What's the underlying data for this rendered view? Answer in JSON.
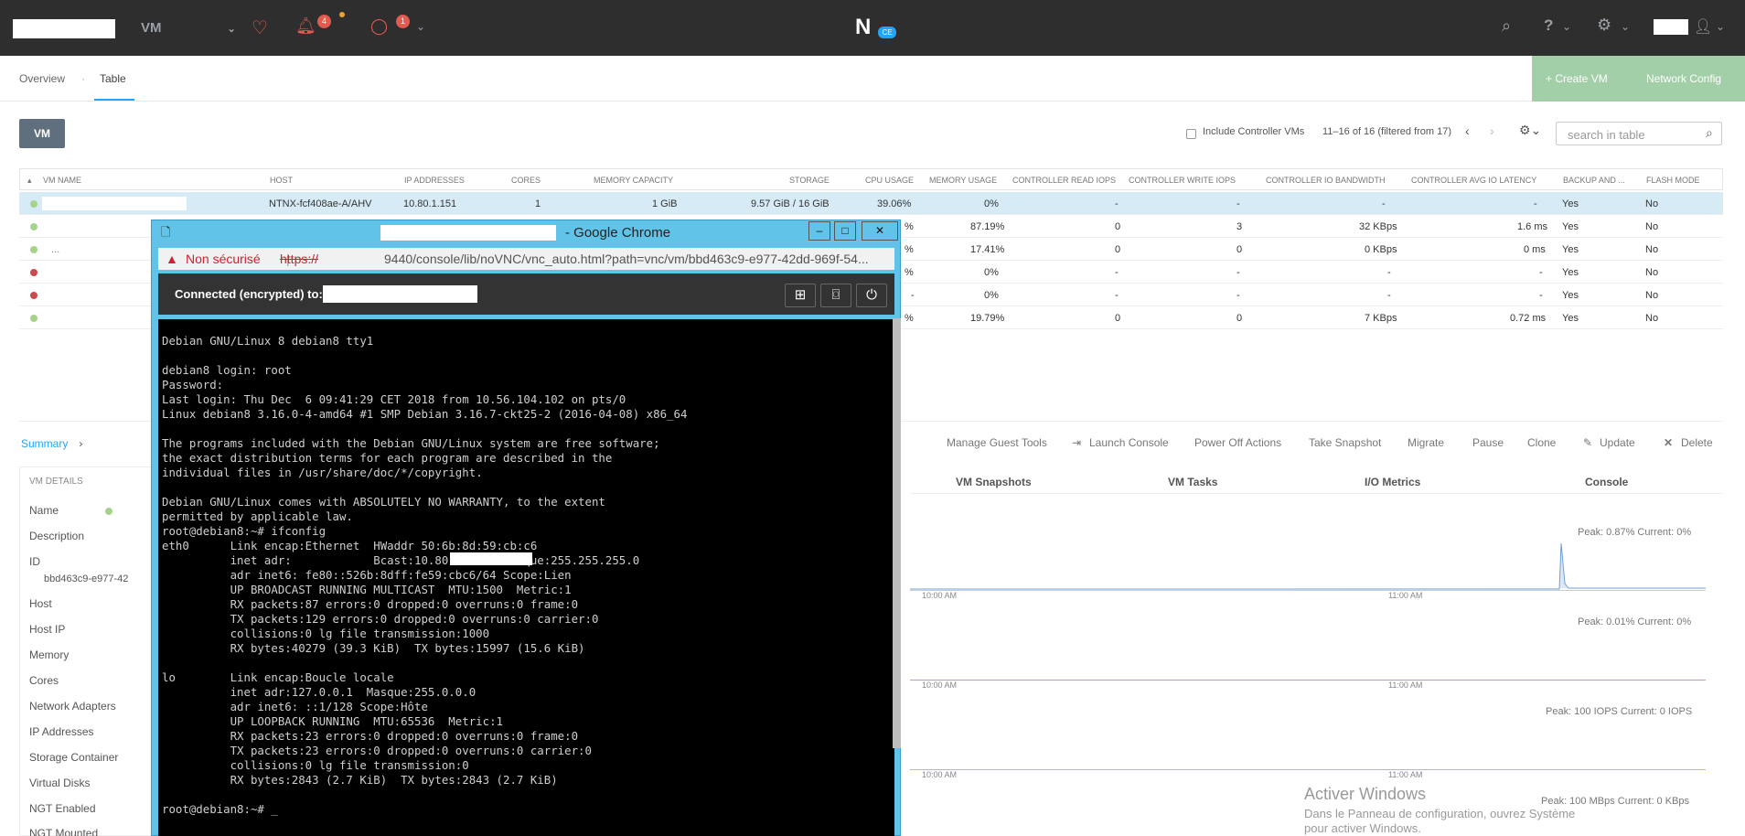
{
  "topbar": {
    "section": "VM",
    "alerts_count": "4",
    "tasks_count": "1",
    "logo": "N",
    "logo_badge": "CE"
  },
  "nav": {
    "tabs": [
      "Overview",
      "Table"
    ],
    "create_vm": "+   Create VM",
    "network_config": "Network Config"
  },
  "toolbar": {
    "vm_button": "VM",
    "include_cvms": "Include Controller VMs",
    "range": "11–16 of 16 (filtered from 17)",
    "search_placeholder": "search in table"
  },
  "table": {
    "headers": [
      "VM NAME",
      "HOST",
      "IP ADDRESSES",
      "CORES",
      "MEMORY CAPACITY",
      "STORAGE",
      "CPU USAGE",
      "MEMORY USAGE",
      "CONTROLLER READ IOPS",
      "CONTROLLER WRITE IOPS",
      "CONTROLLER IO BANDWIDTH",
      "CONTROLLER AVG IO LATENCY",
      "BACKUP AND ...",
      "FLASH MODE"
    ],
    "rows": [
      {
        "status": "green",
        "host": "NTNX-fcf408ae-A/AHV",
        "ip": "10.80.1.151",
        "cores": "1",
        "mem": "1 GiB",
        "storage": "9.57 GiB / 16 GiB",
        "cpu": "39.06%",
        "memu": "0%",
        "rd": "-",
        "wr": "-",
        "bw": "-",
        "lat": "-",
        "backup": "Yes",
        "flash": "No"
      },
      {
        "status": "green",
        "cpu": "%",
        "memu": "87.19%",
        "rd": "0",
        "wr": "3",
        "bw": "32 KBps",
        "lat": "1.6 ms",
        "backup": "Yes",
        "flash": "No"
      },
      {
        "status": "green",
        "name": "...",
        "cpu": "%",
        "memu": "17.41%",
        "rd": "0",
        "wr": "0",
        "bw": "0 KBps",
        "lat": "0 ms",
        "backup": "Yes",
        "flash": "No"
      },
      {
        "status": "red",
        "cpu": "%",
        "memu": "0%",
        "rd": "-",
        "wr": "-",
        "bw": "-",
        "lat": "-",
        "backup": "Yes",
        "flash": "No"
      },
      {
        "status": "red",
        "cpu": "-",
        "memu": "0%",
        "rd": "-",
        "wr": "-",
        "bw": "-",
        "lat": "-",
        "backup": "Yes",
        "flash": "No"
      },
      {
        "status": "green",
        "cpu": "%",
        "memu": "19.79%",
        "rd": "0",
        "wr": "0",
        "bw": "7 KBps",
        "lat": "0.72 ms",
        "backup": "Yes",
        "flash": "No"
      }
    ]
  },
  "summary": {
    "link": "Summary",
    "actions": [
      "Manage Guest Tools",
      "Launch Console",
      "Power Off Actions",
      "Take Snapshot",
      "Migrate",
      "Pause",
      "Clone",
      "Update",
      "Delete"
    ],
    "tabs": [
      "VM Snapshots",
      "VM Tasks",
      "I/O Metrics",
      "Console"
    ]
  },
  "details": {
    "title": "VM DETAILS",
    "labels": [
      "Name",
      "Description",
      "ID",
      "Host",
      "Host IP",
      "Memory",
      "Cores",
      "Network Adapters",
      "IP Addresses",
      "Storage Container",
      "Virtual Disks",
      "NGT Enabled",
      "NGT Mounted"
    ],
    "id_value": "bbd463c9-e977-42"
  },
  "metrics": {
    "peaks": [
      "Peak: 0.87%   Current: 0%",
      "Peak: 0.01%   Current: 0%",
      "Peak: 100 IOPS   Current: 0 IOPS",
      "Peak: 100 MBps   Current: 0 KBps"
    ],
    "ticks": [
      "10:00 AM",
      "11:00 AM"
    ]
  },
  "chrome": {
    "title": "- Google Chrome",
    "not_secure": "Non sécurisé",
    "url_scheme": "https://",
    "url_rest": "9440/console/lib/noVNC/vnc_auto.html?path=vnc/vm/bbd463c9-e977-42dd-969f-54...",
    "connected": "Connected (encrypted) to:"
  },
  "terminal": {
    "lines": [
      "",
      "Debian GNU/Linux 8 debian8 tty1",
      "",
      "debian8 login: root",
      "Password:",
      "Last login: Thu Dec  6 09:41:29 CET 2018 from 10.56.104.102 on pts/0",
      "Linux debian8 3.16.0-4-amd64 #1 SMP Debian 3.16.7-ckt25-2 (2016-04-08) x86_64",
      "",
      "The programs included with the Debian GNU/Linux system are free software;",
      "the exact distribution terms for each program are described in the",
      "individual files in /usr/share/doc/*/copyright.",
      "",
      "Debian GNU/Linux comes with ABSOLUTELY NO WARRANTY, to the extent",
      "permitted by applicable law.",
      "root@debian8:~# ifconfig",
      "eth0      Link encap:Ethernet  HWaddr 50:6b:8d:59:cb:c6",
      "          inet adr:            Bcast:10.80.1.255  Masque:255.255.255.0",
      "          adr inet6: fe80::526b:8dff:fe59:cbc6/64 Scope:Lien",
      "          UP BROADCAST RUNNING MULTICAST  MTU:1500  Metric:1",
      "          RX packets:87 errors:0 dropped:0 overruns:0 frame:0",
      "          TX packets:129 errors:0 dropped:0 overruns:0 carrier:0",
      "          collisions:0 lg file transmission:1000",
      "          RX bytes:40279 (39.3 KiB)  TX bytes:15997 (15.6 KiB)",
      "",
      "lo        Link encap:Boucle locale",
      "          inet adr:127.0.0.1  Masque:255.0.0.0",
      "          adr inet6: ::1/128 Scope:Hôte",
      "          UP LOOPBACK RUNNING  MTU:65536  Metric:1",
      "          RX packets:23 errors:0 dropped:0 overruns:0 frame:0",
      "          TX packets:23 errors:0 dropped:0 overruns:0 carrier:0",
      "          collisions:0 lg file transmission:0",
      "          RX bytes:2843 (2.7 KiB)  TX bytes:2843 (2.7 KiB)",
      "",
      "root@debian8:~# _"
    ]
  },
  "watermark": {
    "title": "Activer Windows",
    "line": "Dans le Panneau de configuration, ouvrez Système pour activer Windows."
  }
}
